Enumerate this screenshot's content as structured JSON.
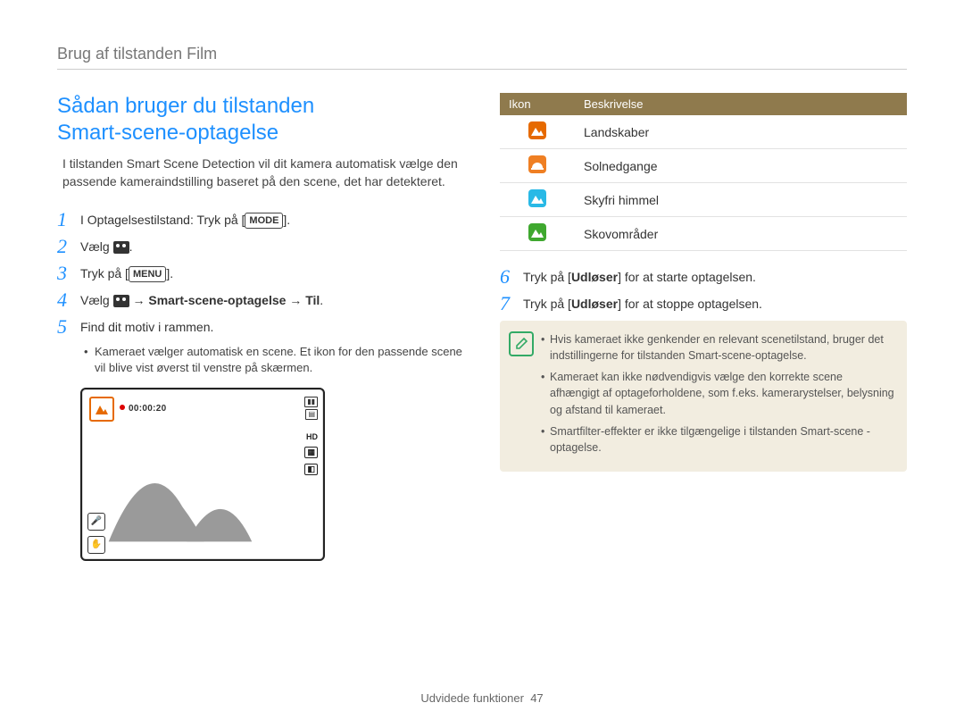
{
  "header": "Brug af tilstanden Film",
  "title_line1": "Sådan bruger du tilstanden",
  "title_line2": "Smart-scene-optagelse",
  "intro": "I tilstanden Smart Scene Detection vil dit kamera automatisk vælge den passende kameraindstilling baseret på den scene, det har detekteret.",
  "steps": {
    "s1_a": "I Optagelsestilstand: Tryk på [",
    "s1_btn": "MODE",
    "s1_b": "].",
    "s2": "Vælg ",
    "s2_b": ".",
    "s3_a": "Tryk på [",
    "s3_btn": "MENU",
    "s3_b": "].",
    "s4_a": "Vælg ",
    "s4_bold": "→ Smart-scene-optagelse → Til",
    "s4_b": ".",
    "s5": "Find dit motiv i rammen.",
    "s5_bullet": "Kameraet vælger automatisk en scene. Et ikon for den passende scene vil blive vist øverst til venstre på skærmen.",
    "s6_a": "Tryk på [",
    "s6_bold": "Udløser",
    "s6_b": "] for at starte optagelsen.",
    "s7_a": "Tryk på [",
    "s7_bold": "Udløser",
    "s7_b": "] for at stoppe optagelsen."
  },
  "lcd": {
    "time": "00:00:20",
    "hd": "HD"
  },
  "table": {
    "h1": "Ikon",
    "h2": "Beskrivelse",
    "rows": [
      {
        "label": "Landskaber"
      },
      {
        "label": "Solnedgange"
      },
      {
        "label": "Skyfri himmel"
      },
      {
        "label": "Skovområder"
      }
    ]
  },
  "notes": [
    "Hvis kameraet ikke genkender en relevant scenetilstand, bruger det indstillingerne for tilstanden Smart-scene-optagelse.",
    "Kameraet kan ikke nødvendigvis vælge den korrekte scene afhængigt af optageforholdene, som f.eks. kamerarystelser, belysning og afstand til kameraet.",
    "Smartfilter-effekter er ikke tilgængelige i tilstanden Smart-scene -optagelse."
  ],
  "footer_text": "Udvidede funktioner",
  "footer_page": "47"
}
